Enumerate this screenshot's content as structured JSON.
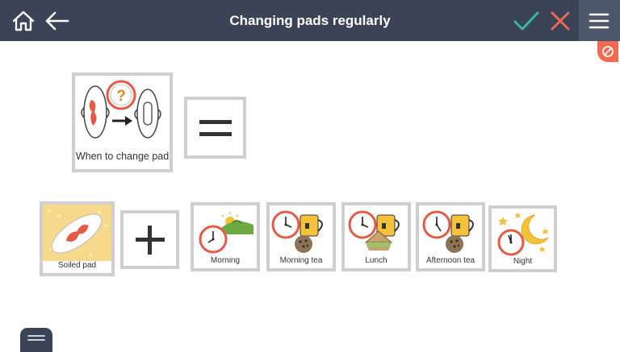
{
  "header": {
    "title": "Changing pads regularly",
    "icons": [
      "home-icon",
      "back-arrow-icon",
      "checkmark-icon",
      "close-icon",
      "hamburger-menu-icon"
    ]
  },
  "colors": {
    "topbar": "#3b4456",
    "accent_check": "#37b9a4",
    "accent_close": "#f26b4f",
    "card_border": "#cfcfcf"
  },
  "badge": {
    "icon": "no-entry-icon"
  },
  "main_card": {
    "label": "When to change pad"
  },
  "operators": {
    "equals": "=",
    "plus": "+"
  },
  "cards": [
    {
      "label": "Soiled pad"
    },
    {
      "label": "Morning"
    },
    {
      "label": "Morning tea"
    },
    {
      "label": "Lunch"
    },
    {
      "label": "Afternoon tea"
    },
    {
      "label": "Night"
    }
  ]
}
